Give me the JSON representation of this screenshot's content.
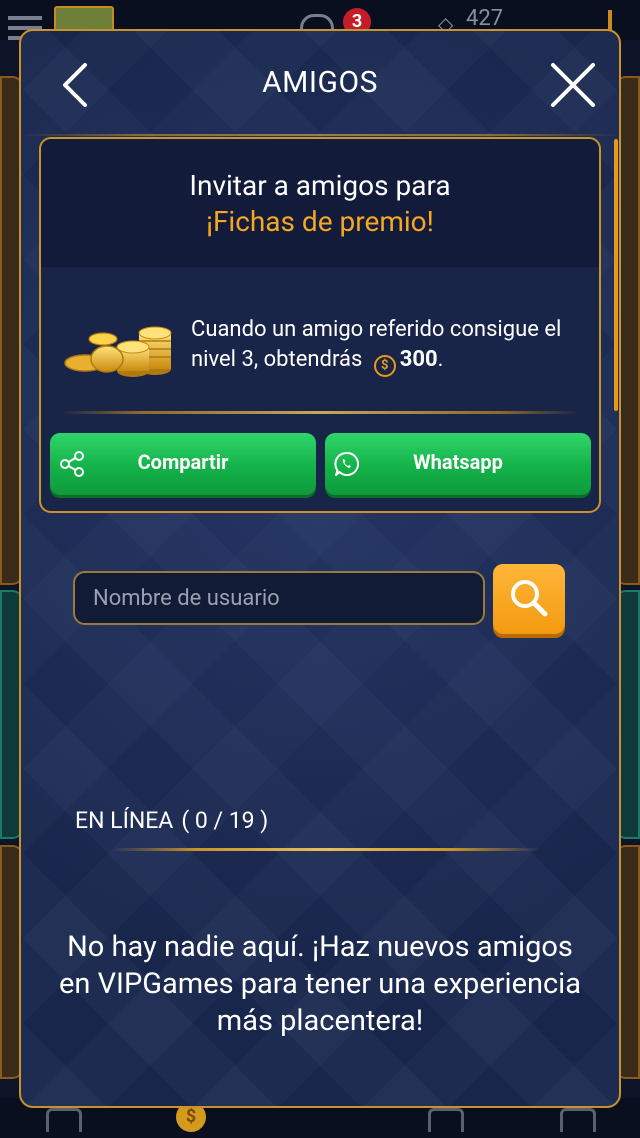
{
  "background": {
    "badge_count": "3",
    "gems": "427"
  },
  "modal": {
    "title": "AMIGOS",
    "invite": {
      "line1": "Invitar a amigos para",
      "line2": "¡Fichas de premio!",
      "reward_text": "Cuando un amigo referido consigue el nivel 3, obtendrás",
      "reward_amount": "300",
      "reward_suffix": ".",
      "coin_symbol": "$"
    },
    "buttons": {
      "share_label": "Compartir",
      "whatsapp_label": "Whatsapp"
    },
    "search": {
      "placeholder": "Nombre de usuario",
      "value": ""
    },
    "online": {
      "label": "EN LÍNEA",
      "count": "( 0 / 19 )"
    },
    "empty_message": "No hay nadie aquí. ¡Haz nuevos amigos en VIPGames para tener una experiencia más placentera!"
  },
  "colors": {
    "accent_gold": "#c9922a",
    "highlight_orange": "#f5a623",
    "button_green": "#14b24a",
    "modal_bg": "#1a2850"
  }
}
